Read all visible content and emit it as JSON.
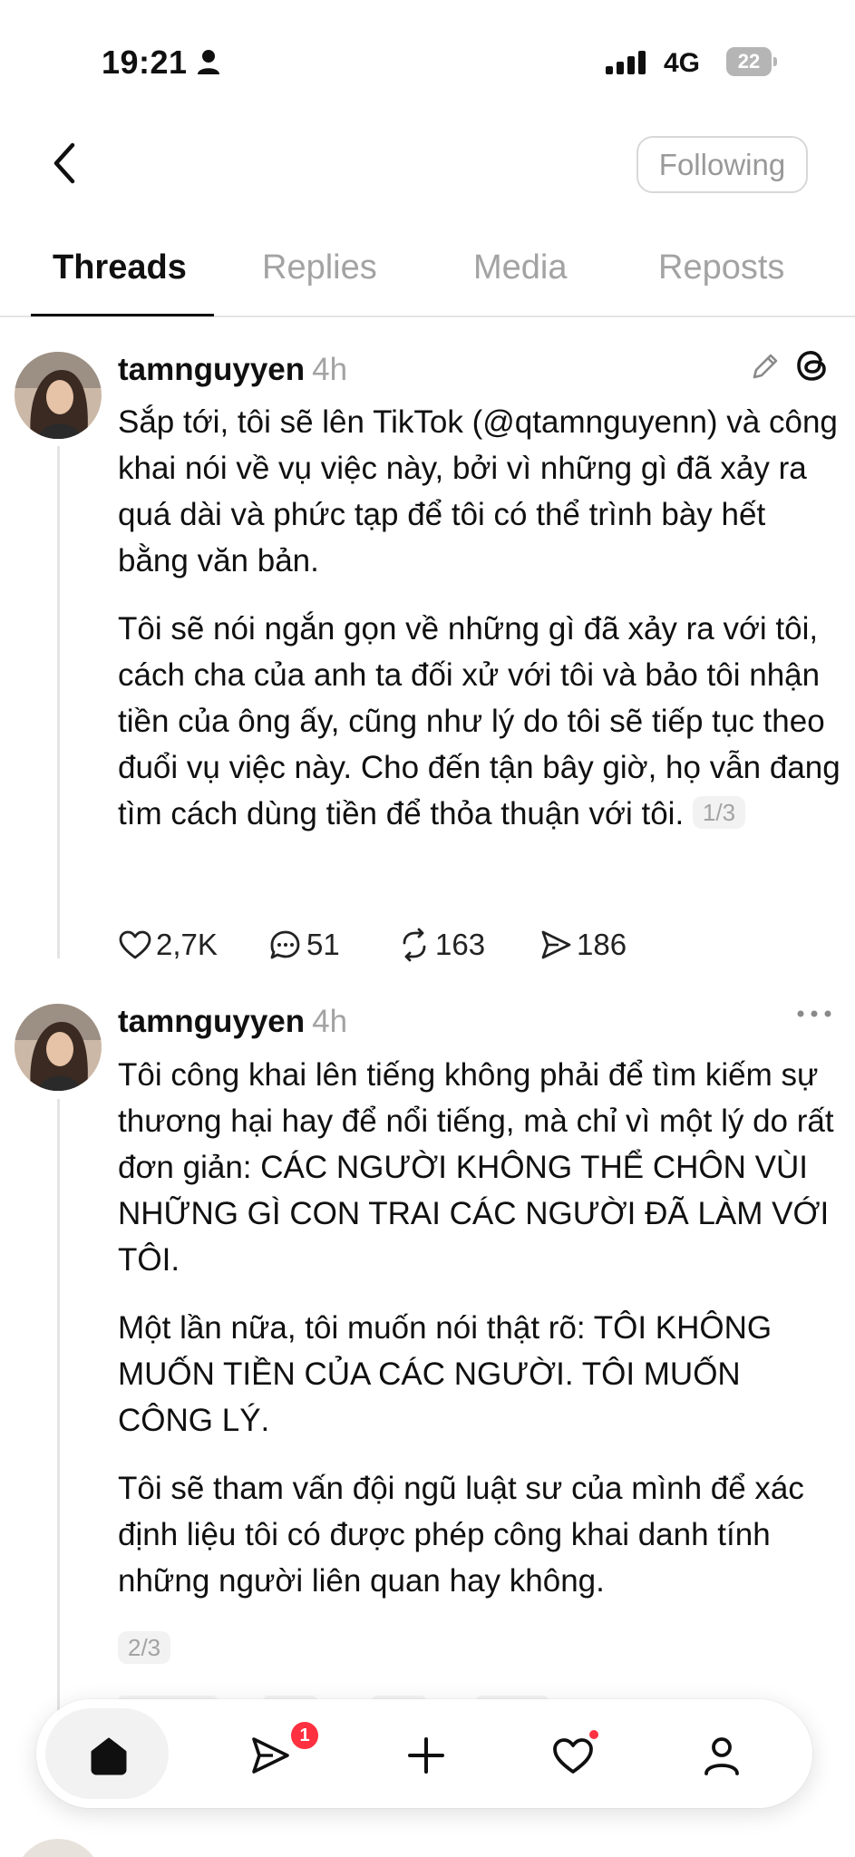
{
  "status_bar": {
    "time": "19:21",
    "network": "4G",
    "battery_level": "22"
  },
  "header": {
    "back_icon": "chevron-left-icon",
    "following_label": "Following"
  },
  "tabs": [
    {
      "label": "Threads",
      "active": true
    },
    {
      "label": "Replies",
      "active": false
    },
    {
      "label": "Media",
      "active": false
    },
    {
      "label": "Reposts",
      "active": false
    }
  ],
  "posts": [
    {
      "username": "tamnguyyen",
      "time": "4h",
      "paragraphs": [
        "Sắp tới, tôi sẽ lên TikTok (@qtamnguyenn) và công khai nói về vụ việc này, bởi vì những gì đã xảy ra quá dài và phức tạp để tôi có thể trình bày hết bằng văn bản.",
        "Tôi sẽ nói ngắn gọn về những gì đã xảy ra với tôi, cách cha của anh ta đối xử với tôi và bảo tôi nhận tiền của ông ấy, cũng như lý do tôi sẽ tiếp tục theo đuổi vụ việc này. Cho đến tận bây giờ, họ vẫn đang tìm cách dùng tiền để thỏa thuận với tôi."
      ],
      "page_indicator": "1/3",
      "likes": "2,7K",
      "comments": "51",
      "reposts": "163",
      "shares": "186"
    },
    {
      "username": "tamnguyyen",
      "time": "4h",
      "paragraphs": [
        "Tôi công khai lên tiếng không phải để tìm kiếm sự thương hại hay để nổi tiếng, mà chỉ vì một lý do rất đơn giản: CÁC NGƯỜI KHÔNG THỂ CHÔN VÙI NHỮNG GÌ CON TRAI CÁC NGƯỜI ĐÃ LÀM VỚI TÔI.",
        "Một lần nữa, tôi muốn nói thật rõ: TÔI KHÔNG MUỐN TIỀN CỦA CÁC NGƯỜI. TÔI MUỐN CÔNG LÝ.",
        "Tôi sẽ tham vấn đội ngũ luật sư của mình để xác định liệu tôi có được phép công khai danh tính những người liên quan hay không."
      ],
      "page_indicator": "2/3"
    }
  ],
  "bottom_nav": {
    "items": [
      "home-icon",
      "send-icon",
      "plus-icon",
      "heart-icon",
      "profile-icon"
    ],
    "notification_count": "1"
  },
  "colors": {
    "text": "#101010",
    "muted": "#a3a3a3",
    "badge": "#ff3040"
  }
}
